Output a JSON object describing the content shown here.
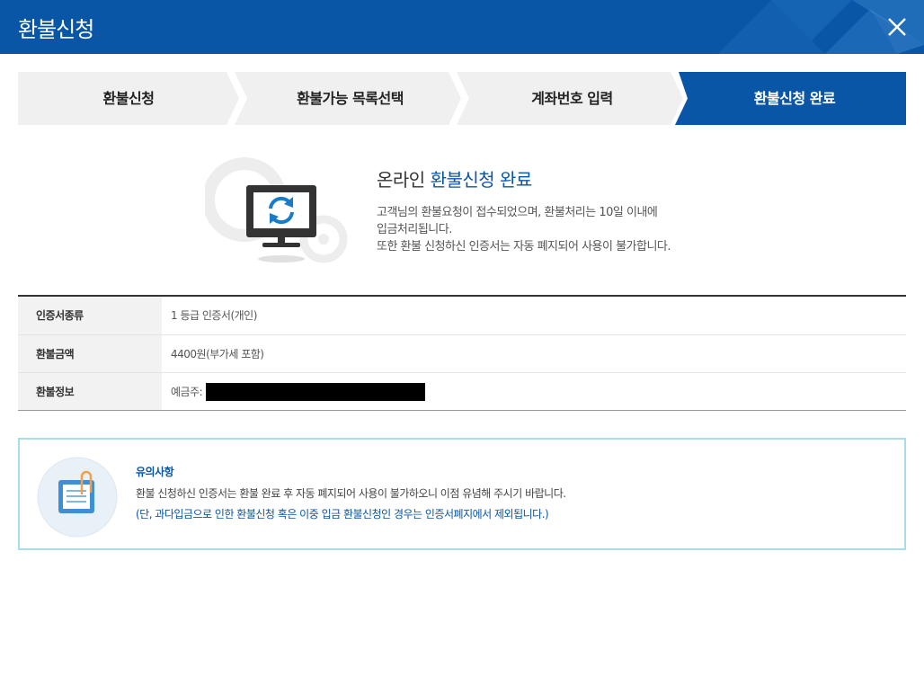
{
  "header": {
    "title": "환불신청"
  },
  "steps": [
    {
      "label": "환불신청",
      "active": false
    },
    {
      "label": "환불가능 목록선택",
      "active": false
    },
    {
      "label": "계좌번호 입력",
      "active": false
    },
    {
      "label": "환불신청 완료",
      "active": true
    }
  ],
  "hero": {
    "title_prefix": "온라인 ",
    "title_accent": "환불신청 완료",
    "desc_line1": "고객님의 환불요청이 접수되었으며, 환불처리는 10일 이내에",
    "desc_line2": "입금처리됩니다.",
    "desc_line3": "또한 환불 신청하신 인증서는 자동 폐지되어 사용이 불가합니다."
  },
  "info": {
    "rows": [
      {
        "label": "인증서종류",
        "value": "1 등급 인증서(개인)"
      },
      {
        "label": "환불금액",
        "value": "4400원(부가세 포함)"
      },
      {
        "label": "환불정보",
        "value": "예금주:"
      }
    ]
  },
  "notice": {
    "title": "유의사항",
    "line1": "환불 신청하신 인증서는 환불 완료 후 자동 폐지되어 사용이 불가하오니 이점 유념해 주시기 바랍니다.",
    "line2": "(단, 과다입금으로 인한 환불신청 혹은 이중 입금 환불신청인 경우는 인증서폐지에서 제외됩니다.)"
  },
  "colors": {
    "primary": "#0a56a6",
    "step_bg": "#f0f0f0",
    "notice_border": "#a6dde6"
  },
  "icons": {
    "close": "close-icon",
    "hero": "monitor-refresh-icon",
    "notice": "clipboard-note-icon"
  }
}
